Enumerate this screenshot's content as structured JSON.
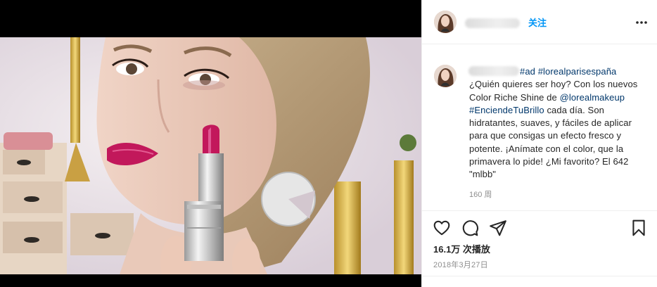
{
  "post": {
    "follow_label": "关注",
    "caption": {
      "hashtags_first": [
        "#ad",
        "#lorealparisespaña"
      ],
      "text_1": "¿Quién quieres ser hoy? Con los nuevos Color Riche Shine de ",
      "mention": "@lorealmakeup",
      "hashtag_2": "#EnciendeTuBrillo",
      "text_2": " cada día. Son hidratantes, suaves, y fáciles de aplicar para que consigas un efecto fresco y potente. ¡Anímate con el color, que la primavera lo pide! ¿Mi favorito? El 642 \"mlbb\""
    },
    "time_ago": "160 周",
    "views": "16.1万 次播放",
    "date": "2018年3月27日"
  },
  "icons": {
    "more": "more-horizontal-icon",
    "like": "heart-icon",
    "comment": "comment-icon",
    "share": "paper-plane-icon",
    "save": "bookmark-icon",
    "mute": "speaker-muted-icon"
  },
  "colors": {
    "link": "#00376b",
    "follow": "#0095f6",
    "secondary_text": "#8e8e8e",
    "lipstick": "#c2185b"
  }
}
